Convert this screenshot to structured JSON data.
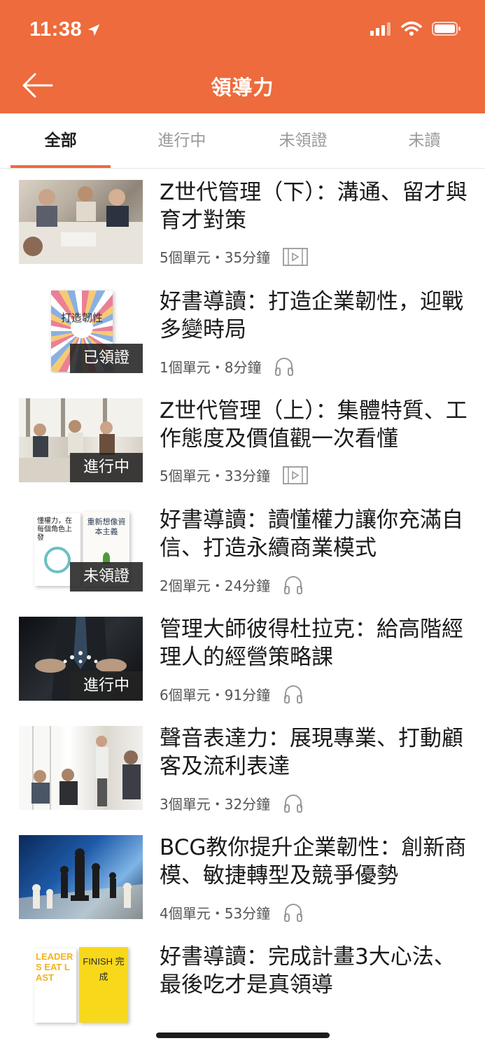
{
  "status_bar": {
    "time": "11:38"
  },
  "header": {
    "title": "領導力"
  },
  "tabs": [
    {
      "label": "全部",
      "active": true
    },
    {
      "label": "進行中",
      "active": false
    },
    {
      "label": "未領證",
      "active": false
    },
    {
      "label": "未讀",
      "active": false
    }
  ],
  "courses": [
    {
      "title": "Z世代管理（下）：溝通、留才與育才對策",
      "meta": "5個單元・35分鐘",
      "media_icon": "video-icon",
      "badge": ""
    },
    {
      "title": "好書導讀：打造企業韌性，迎戰多變時局",
      "meta": "1個單元・8分鐘",
      "media_icon": "headphones-icon",
      "badge": "已領證",
      "cover_text": "打造韌性"
    },
    {
      "title": "Z世代管理（上）：集體特質、工作態度及價值觀一次看懂",
      "meta": "5個單元・33分鐘",
      "media_icon": "video-icon",
      "badge": "進行中"
    },
    {
      "title": "好書導讀：讀懂權力讓你充滿自信、打造永續商業模式",
      "meta": "2個單元・24分鐘",
      "media_icon": "headphones-icon",
      "badge": "未領證",
      "cover_text_1": "懂權力，在每個角色上發",
      "cover_text_2": "重新想像資本主義"
    },
    {
      "title": "管理大師彼得杜拉克：給高階經理人的經營策略課",
      "meta": "6個單元・91分鐘",
      "media_icon": "headphones-icon",
      "badge": "進行中"
    },
    {
      "title": "聲音表達力：展現專業、打動顧客及流利表達",
      "meta": "3個單元・32分鐘",
      "media_icon": "headphones-icon",
      "badge": ""
    },
    {
      "title": "BCG教你提升企業韌性：創新商模、敏捷轉型及競爭優勢",
      "meta": "4個單元・53分鐘",
      "media_icon": "headphones-icon",
      "badge": ""
    },
    {
      "title": "好書導讀：完成計畫3大心法、最後吃才是真領導",
      "meta": "",
      "media_icon": "",
      "badge": "",
      "cover_text_1": "LEADERS EAT LAST",
      "cover_text_2": "FINISH 完成"
    }
  ],
  "colors": {
    "accent": "#ed6b3c",
    "badge_bg": "#232323"
  }
}
